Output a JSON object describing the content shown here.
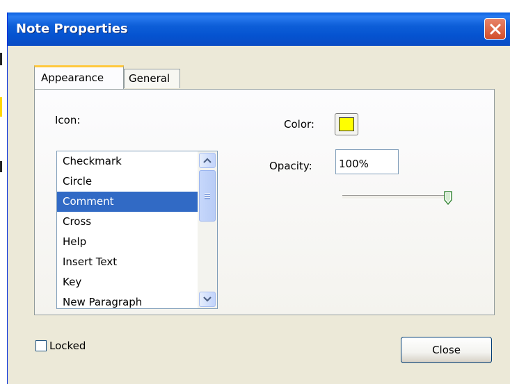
{
  "window": {
    "title": "Note Properties",
    "close_icon": "close-icon"
  },
  "tabs": [
    {
      "label": "Appearance",
      "active": true
    },
    {
      "label": "General",
      "active": false
    }
  ],
  "appearance": {
    "icon_label": "Icon:",
    "icon_list": [
      {
        "label": "Checkmark",
        "selected": false
      },
      {
        "label": "Circle",
        "selected": false
      },
      {
        "label": "Comment",
        "selected": true
      },
      {
        "label": "Cross",
        "selected": false
      },
      {
        "label": "Help",
        "selected": false
      },
      {
        "label": "Insert Text",
        "selected": false
      },
      {
        "label": "Key",
        "selected": false
      },
      {
        "label": "New Paragraph",
        "selected": false
      }
    ],
    "color_label": "Color:",
    "color_value": "#ffff00",
    "opacity_label": "Opacity:",
    "opacity_value": "100%",
    "opacity_fraction": 1.0
  },
  "locked_label": "Locked",
  "locked_checked": false,
  "close_button_label": "Close",
  "colors": {
    "titlebar": "#0553d0",
    "selection": "#316ac5",
    "dialog_bg": "#ece9d8",
    "tab_accent": "#ffc83c"
  }
}
